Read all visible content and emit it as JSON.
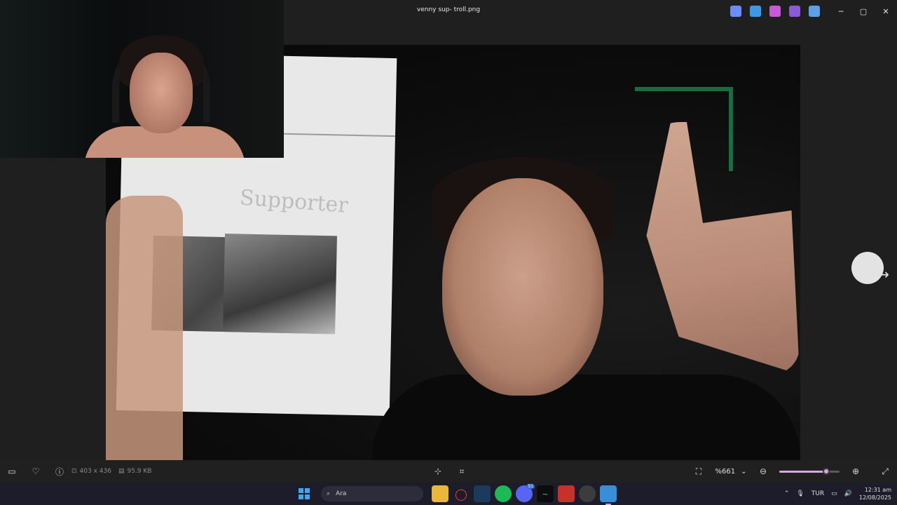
{
  "window": {
    "title": "venny sup- troll.png",
    "minimize": "─",
    "maximize": "▢",
    "close": "✕"
  },
  "titlebar_tools": [
    {
      "icon": "copilot-icon",
      "color": "#6b8cff"
    },
    {
      "icon": "edit-icon",
      "color": "#3a9ae8"
    },
    {
      "icon": "erase-icon",
      "color": "#c85ad8"
    },
    {
      "icon": "effects-icon",
      "color": "#8b5ad8"
    },
    {
      "icon": "onedrive-icon",
      "color": "#5aa0e8"
    }
  ],
  "image_text": {
    "paper_scribble": "Supporter"
  },
  "status": {
    "dimensions": "403 x 436",
    "filesize": "95.9 KB"
  },
  "zoom": {
    "value": "%661",
    "level": 0.78
  },
  "taskbar": {
    "search_placeholder": "Ara",
    "discord_badge": "51",
    "language": "TUR",
    "time": "12:31 am",
    "date": "12/08/2025"
  }
}
